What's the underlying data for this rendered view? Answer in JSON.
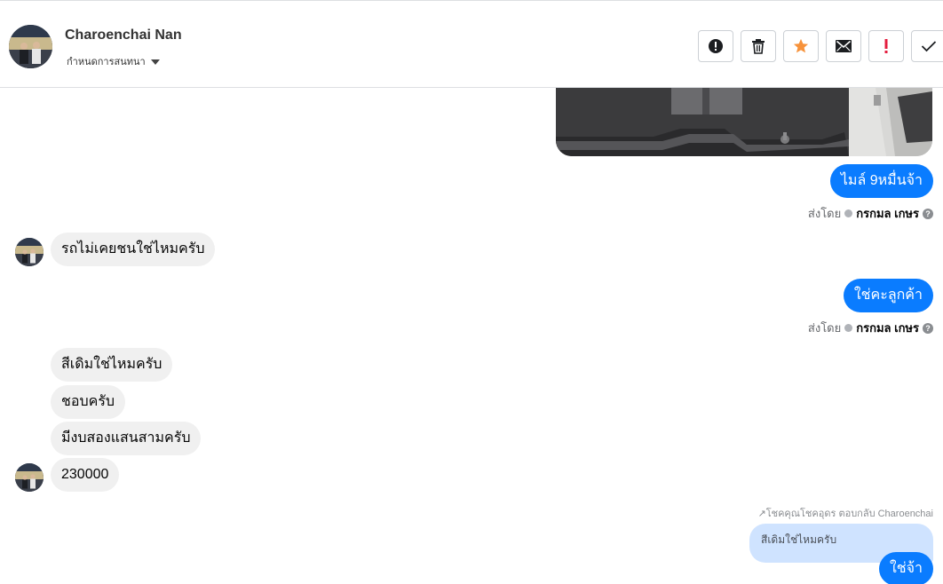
{
  "header": {
    "contact_name": "Charoenchai Nan",
    "status_label": "กำหนดการสนทนา",
    "actions": [
      "spam-icon",
      "trash-icon",
      "star-icon",
      "mail-icon",
      "important-icon",
      "check-icon"
    ]
  },
  "colors": {
    "outgoing_bubble": "#0a7cff",
    "incoming_bubble": "#f0f0f0",
    "star": "#f7923a",
    "important": "#e41e3f",
    "quoted_bg": "#cfe3ff"
  },
  "messages": {
    "m1_out": "ไมล์ 9หมื่นจ้า",
    "sent_by_label": "ส่งโดย",
    "sender_name": "กรกมล เกษร",
    "m2_in": "รถไม่เคยชนใช่ไหมครับ",
    "m3_out": "ใช่คะลูกค้า",
    "m4_in": "สีเดิมใช่ไหมครับ",
    "m5_in": "ชอบครับ",
    "m6_in": "มีงบสองแสนสามครับ",
    "m7_in": "230000",
    "reply_note": "↗โชคคุณโชคอุดร ตอบกลับ Charoenchai",
    "quoted_text": "สีเดิมใช่ไหมครับ",
    "m8_out": "ใช่จ้า"
  }
}
